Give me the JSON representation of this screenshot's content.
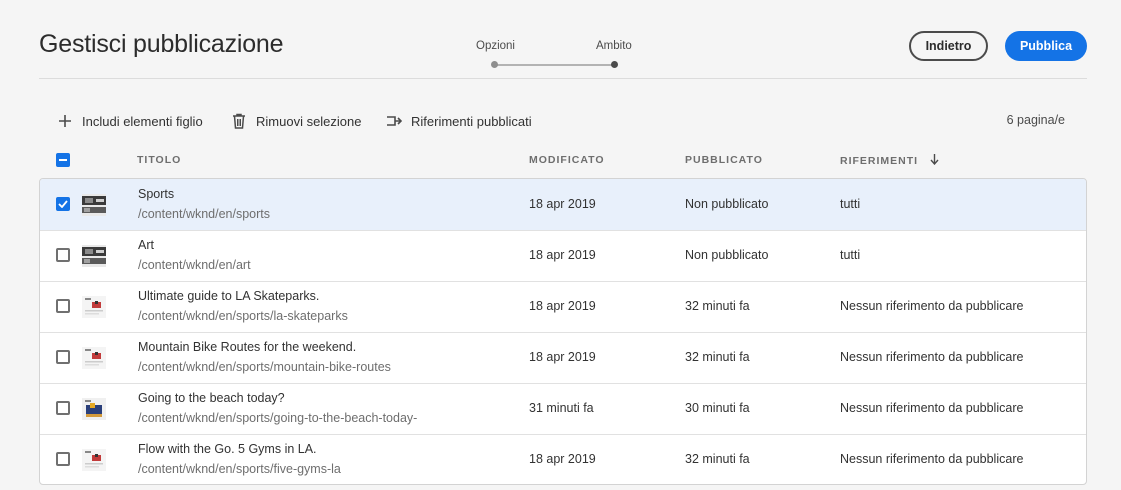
{
  "header": {
    "title": "Gestisci pubblicazione",
    "steps": [
      "Opzioni",
      "Ambito"
    ],
    "back_label": "Indietro",
    "publish_label": "Pubblica"
  },
  "toolbar": {
    "include_children": "Includi elementi figlio",
    "remove_selection": "Rimuovi selezione",
    "published_references": "Riferimenti pubblicati",
    "page_count": "6 pagina/e"
  },
  "columns": {
    "title": "TITOLO",
    "modified": "MODIFICATO",
    "published": "PUBBLICATO",
    "references": "RIFERIMENTI"
  },
  "rows": [
    {
      "title": "Sports",
      "path": "/content/wknd/en/sports",
      "modified": "18 apr 2019",
      "published": "Non pubblicato",
      "references": "tutti",
      "checked": true,
      "thumb": "sports"
    },
    {
      "title": "Art",
      "path": "/content/wknd/en/art",
      "modified": "18 apr 2019",
      "published": "Non pubblicato",
      "references": "tutti",
      "checked": false,
      "thumb": "sports"
    },
    {
      "title": "Ultimate guide to LA Skateparks.",
      "path": "/content/wknd/en/sports/la-skateparks",
      "modified": "18 apr 2019",
      "published": "32 minuti fa",
      "references": "Nessun riferimento da pubblicare",
      "checked": false,
      "thumb": "doc"
    },
    {
      "title": "Mountain Bike Routes for the weekend.",
      "path": "/content/wknd/en/sports/mountain-bike-routes",
      "modified": "18 apr 2019",
      "published": "32 minuti fa",
      "references": "Nessun riferimento da pubblicare",
      "checked": false,
      "thumb": "doc"
    },
    {
      "title": "Going to the beach today?",
      "path": "/content/wknd/en/sports/going-to-the-beach-today-",
      "modified": "31 minuti fa",
      "published": "30 minuti fa",
      "references": "Nessun riferimento da pubblicare",
      "checked": false,
      "thumb": "beach"
    },
    {
      "title": "Flow with the Go. 5 Gyms in LA.",
      "path": "/content/wknd/en/sports/five-gyms-la",
      "modified": "18 apr 2019",
      "published": "32 minuti fa",
      "references": "Nessun riferimento da pubblicare",
      "checked": false,
      "thumb": "doc"
    }
  ],
  "colors": {
    "accent": "#1473e6",
    "selected_row": "#e8f0fb"
  }
}
